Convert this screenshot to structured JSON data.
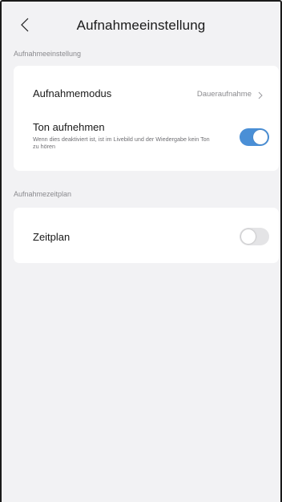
{
  "header": {
    "title": "Aufnahmeeinstellung",
    "back_icon": "chevron-left-icon"
  },
  "section_recording": {
    "label": "Aufnahmeeinstellung",
    "mode": {
      "label": "Aufnahmemodus",
      "value": "Daueraufnahme",
      "icon": "chevron-right-icon"
    },
    "audio": {
      "label": "Ton aufnehmen",
      "description": "Wenn dies deaktiviert ist, ist im Livebild und der Wiedergabe kein Ton zu hören",
      "enabled": true
    }
  },
  "section_schedule": {
    "label": "Aufnahmezeitplan",
    "schedule": {
      "label": "Zeitplan",
      "enabled": false
    }
  },
  "colors": {
    "accent": "#4a8fd6",
    "toggle_off": "#e4e4e6",
    "background": "#f2f2f4"
  }
}
